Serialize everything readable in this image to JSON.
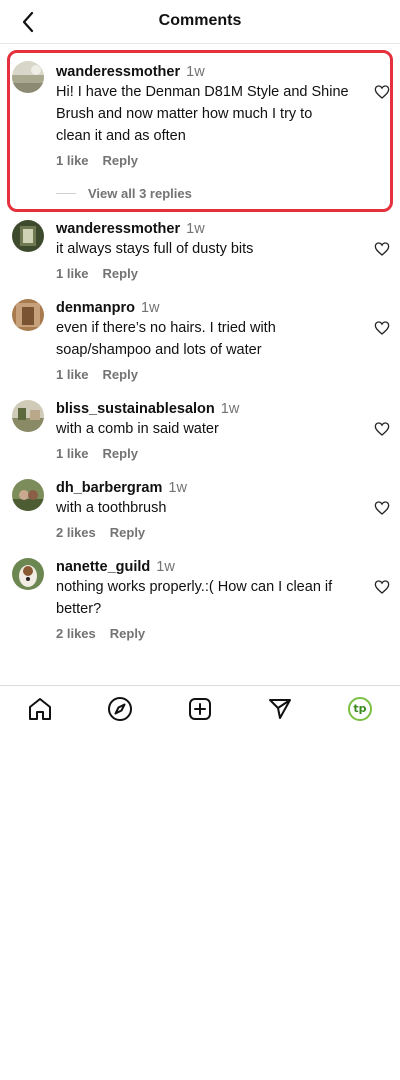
{
  "header": {
    "title": "Comments"
  },
  "comments": [
    {
      "username": "wanderessmother",
      "time": "1w",
      "text": "Hi! I have the Denman D81M Style and Shine Brush and now matter how much I try to clean it and as often",
      "likes": "1 like",
      "reply": "Reply",
      "view_replies": "View all 3 replies"
    },
    {
      "username": "wanderessmother",
      "time": "1w",
      "text": "it always stays full of dusty bits",
      "likes": "1 like",
      "reply": "Reply"
    },
    {
      "username": "denmanpro",
      "time": "1w",
      "text": "even if there’s no hairs. I tried with soap/shampoo and lots of water",
      "likes": "1 like",
      "reply": "Reply"
    },
    {
      "username": "bliss_sustainablesalon",
      "time": "1w",
      "text": "with a comb in said water",
      "likes": "1 like",
      "reply": "Reply"
    },
    {
      "username": "dh_barbergram",
      "time": "1w",
      "text": "with a toothbrush",
      "likes": "2 likes",
      "reply": "Reply"
    },
    {
      "username": "nanette_guild",
      "time": "1w",
      "text": "nothing works properly.:( How can I clean if better?",
      "likes": "2 likes",
      "reply": "Reply"
    }
  ],
  "nav": {
    "profile_initials": "tp"
  },
  "icons": [
    "back-chevron-icon",
    "heart-icon",
    "home-icon",
    "explore-compass-icon",
    "create-plus-icon",
    "direct-send-icon"
  ],
  "colors": {
    "highlight_border": "#e5303e",
    "secondary_text": "#737373",
    "profile_ring": "#7ac043"
  }
}
